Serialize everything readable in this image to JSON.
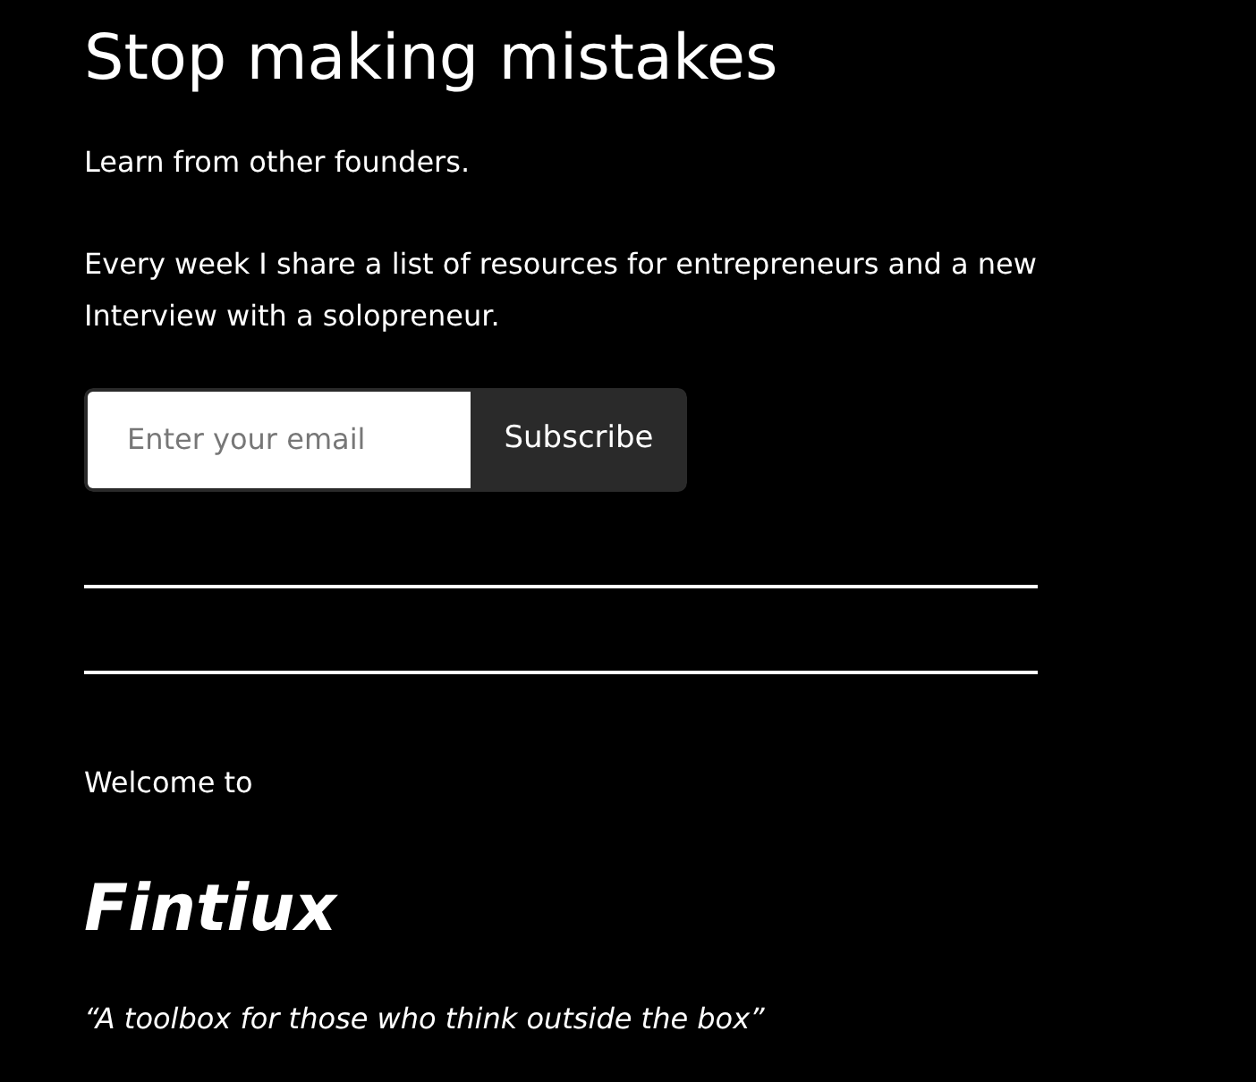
{
  "heading": "Stop making mistakes",
  "intro": "Learn from other founders.",
  "description": "Every week I share a list of resources for entrepreneurs and a new Interview with a solopreneur.",
  "signup": {
    "placeholder": "Enter your email",
    "button": "Subscribe"
  },
  "welcome": "Welcome to",
  "brand": "Fintiux",
  "tagline": "“A toolbox for those who think outside the box”"
}
